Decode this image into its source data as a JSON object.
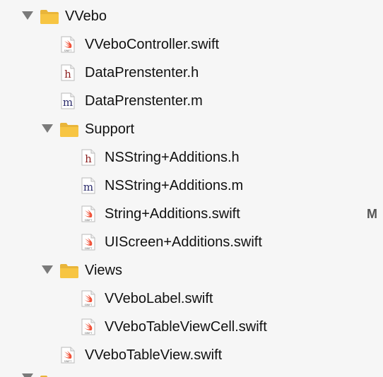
{
  "tree": {
    "vvebo_group": {
      "label": "VVebo",
      "icon": "folder-icon",
      "expanded": true
    },
    "vvebo_controller": {
      "label": "VVeboController.swift",
      "icon": "swift-file-icon"
    },
    "data_presenter_h": {
      "label": "DataPrenstenter.h",
      "icon": "header-file-icon",
      "glyph": "h"
    },
    "data_presenter_m": {
      "label": "DataPrenstenter.m",
      "icon": "objc-file-icon",
      "glyph": "m"
    },
    "support_group": {
      "label": "Support",
      "icon": "folder-icon",
      "expanded": true
    },
    "nsstring_h": {
      "label": "NSString+Additions.h",
      "icon": "header-file-icon",
      "glyph": "h"
    },
    "nsstring_m": {
      "label": "NSString+Additions.m",
      "icon": "objc-file-icon",
      "glyph": "m"
    },
    "string_additions": {
      "label": "String+Additions.swift",
      "icon": "swift-file-icon",
      "status": "M"
    },
    "uiscreen_additions": {
      "label": "UIScreen+Additions.swift",
      "icon": "swift-file-icon"
    },
    "views_group": {
      "label": "Views",
      "icon": "folder-icon",
      "expanded": true
    },
    "vvebo_label": {
      "label": "VVeboLabel.swift",
      "icon": "swift-file-icon"
    },
    "vvebo_tableviewcell": {
      "label": "VVeboTableViewCell.swift",
      "icon": "swift-file-icon"
    },
    "vvebo_tableview": {
      "label": "VVeboTableView.swift",
      "icon": "swift-file-icon"
    }
  },
  "icon_text": {
    "swift": "SWIFT"
  },
  "colors": {
    "background": "#f6f6f6",
    "folder": "#f7c543",
    "folder_dark": "#e9b53a",
    "swift_orange": "#f05138",
    "header_glyph": "#8b1e1e",
    "objc_glyph": "#2b2b6b",
    "disclosure": "#7a7a7a"
  }
}
